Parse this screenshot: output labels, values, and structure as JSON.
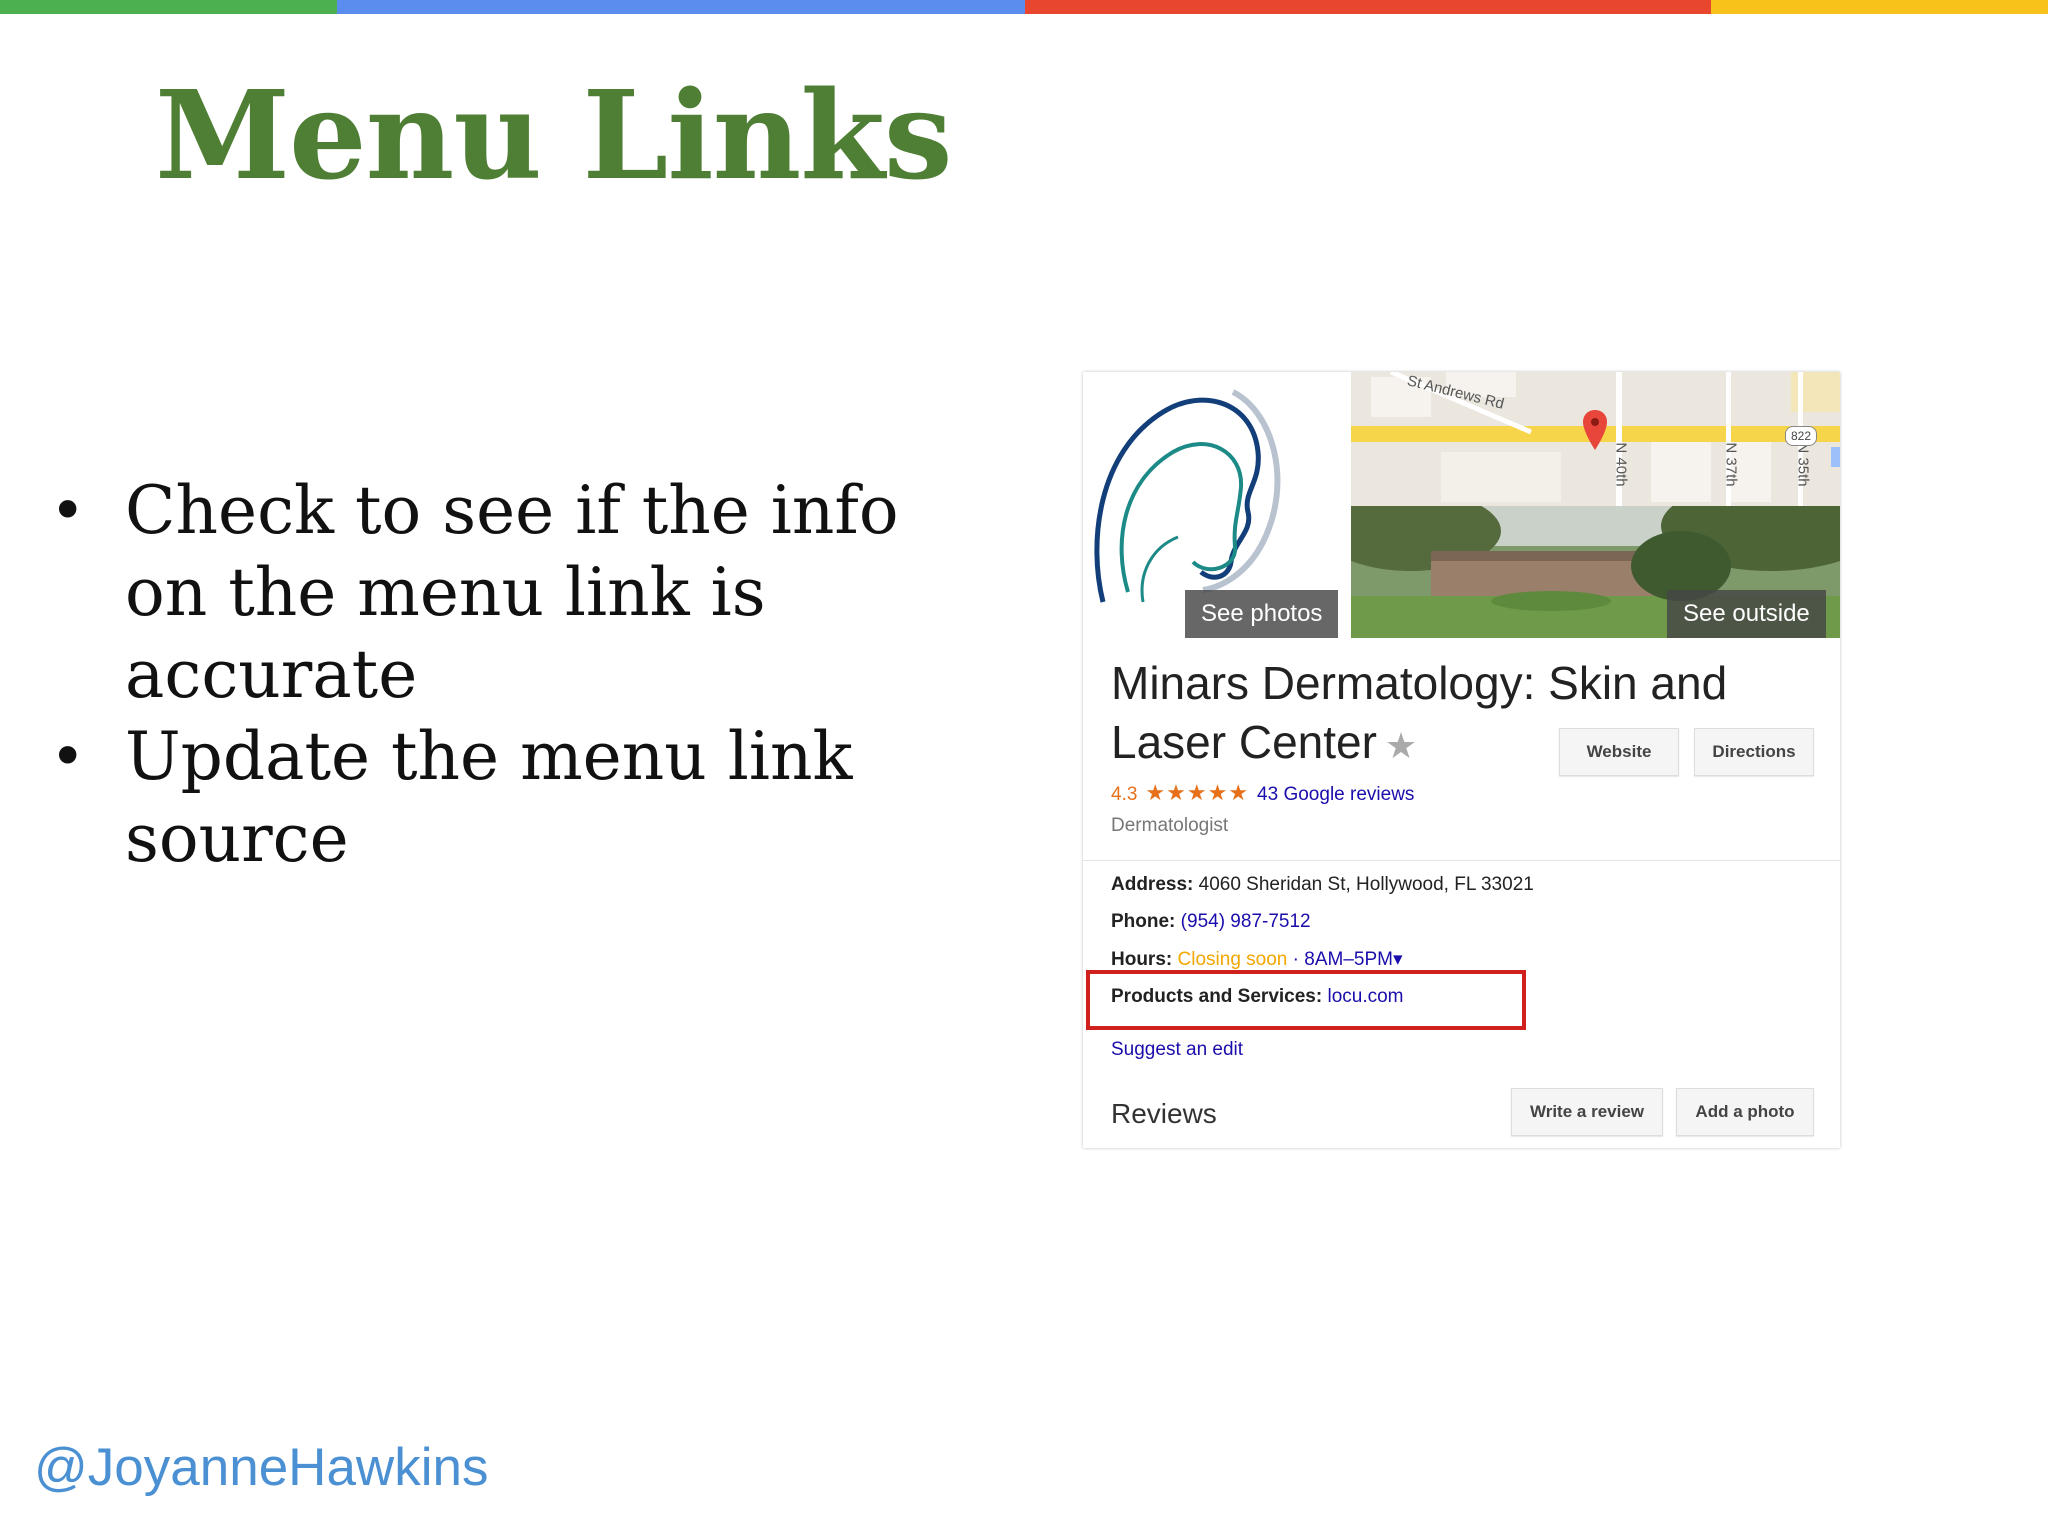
{
  "colors": {
    "bar_green": "#4caf50",
    "bar_blue": "#5b8def",
    "bar_red": "#e8462f",
    "bar_yellow": "#f8c21a",
    "title_green": "#4f7f35",
    "handle_blue": "#4a90d2",
    "highlight_red": "#d0201e"
  },
  "slide": {
    "title": "Menu Links",
    "bullets": [
      "Check to see if the info on the menu link is accurate",
      "Update the menu link source"
    ],
    "handle": "@JoyanneHawkins"
  },
  "panel": {
    "photo_buttons": {
      "see_photos": "See photos",
      "see_outside": "See outside"
    },
    "map_labels": {
      "road": "St Andrews Rd",
      "shield": "822",
      "street_1": "N 40th",
      "street_2": "N 37th",
      "street_3": "N 35th"
    },
    "business_name_line1": "Minars Dermatology: Skin and",
    "business_name_line2": "Laser Center",
    "buttons": {
      "website": "Website",
      "directions": "Directions",
      "write_review": "Write a review",
      "add_photo": "Add a photo"
    },
    "rating": "4.3",
    "stars_text": "★★★★★",
    "reviews_link": "43 Google reviews",
    "category": "Dermatologist",
    "address_label": "Address:",
    "address_value": "4060 Sheridan St, Hollywood, FL 33021",
    "phone_label": "Phone:",
    "phone_value": "(954) 987-7512",
    "hours_label": "Hours:",
    "hours_status": "Closing soon",
    "hours_value": "· 8AM–5PM",
    "products_label": "Products and Services:",
    "products_value": "locu.com",
    "suggest_edit": "Suggest an edit",
    "reviews_heading": "Reviews"
  }
}
